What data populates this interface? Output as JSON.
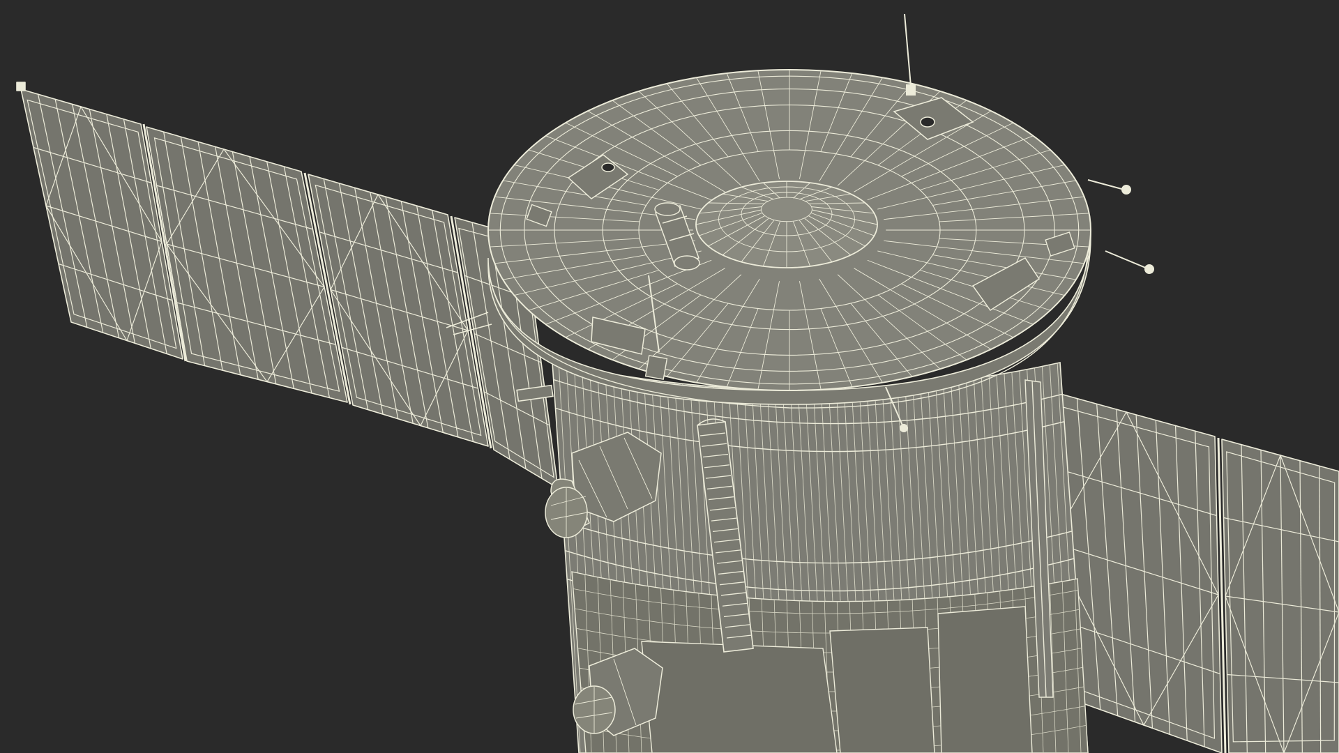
{
  "scene": {
    "subject_icon": "satellite-wireframe-render",
    "colors": {
      "background": "#2a2a2a",
      "surface": "#7c7c74",
      "surface_dark": "#6c6c65",
      "surface_light": "#8b8b82",
      "wire": "#ecebd9",
      "wire_dim": "#c9c8b6",
      "panel_fill": "#75756d"
    }
  }
}
